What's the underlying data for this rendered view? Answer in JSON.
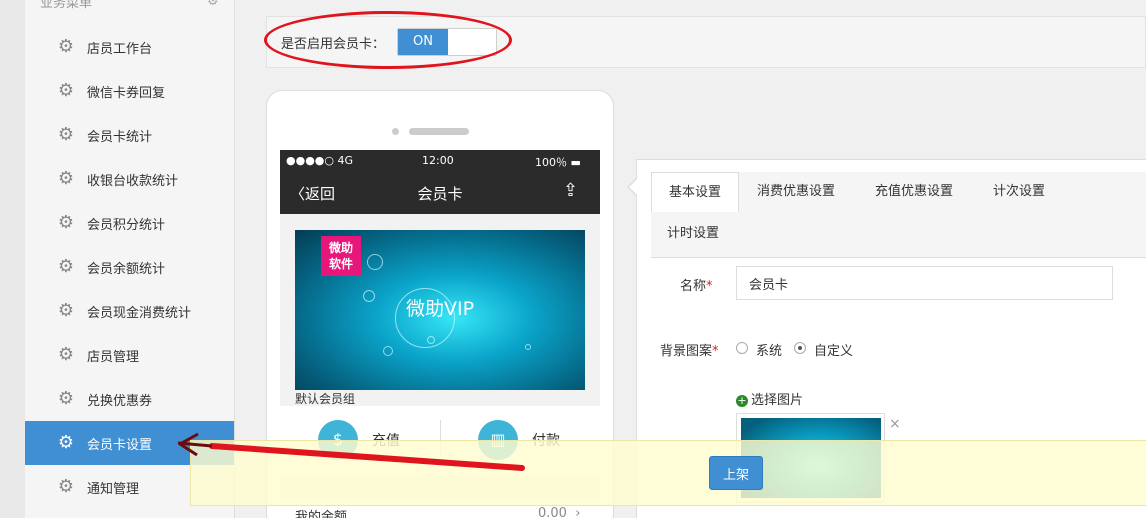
{
  "sidebar": {
    "title": "业务菜单",
    "items": [
      {
        "label": "店员工作台"
      },
      {
        "label": "微信卡券回复"
      },
      {
        "label": "会员卡统计"
      },
      {
        "label": "收银台收款统计"
      },
      {
        "label": "会员积分统计"
      },
      {
        "label": "会员余额统计"
      },
      {
        "label": "会员现金消费统计"
      },
      {
        "label": "店员管理"
      },
      {
        "label": "兑换优惠券"
      },
      {
        "label": "会员卡设置",
        "active": true
      },
      {
        "label": "通知管理"
      }
    ]
  },
  "topbar": {
    "toggle_label": "是否启用会员卡：",
    "toggle_state": "ON"
  },
  "phone": {
    "status": {
      "signal": "●●●●○ 4G",
      "time": "12:00",
      "battery": "100％ ▬"
    },
    "nav": {
      "back": "返回",
      "title": "会员卡"
    },
    "card": {
      "brand_line1": "微助",
      "brand_line2": "软件",
      "title": "微助VIP"
    },
    "group_name": "默认会员组",
    "actions": [
      {
        "label": "充值"
      },
      {
        "label": "付款"
      }
    ],
    "balance": {
      "label": "我的余额",
      "value": "0.00",
      "arrow": "›"
    }
  },
  "form": {
    "tabs": [
      {
        "label": "基本设置",
        "active": true
      },
      {
        "label": "消费优惠设置"
      },
      {
        "label": "充值优惠设置"
      },
      {
        "label": "计次设置"
      },
      {
        "label": "计时设置"
      }
    ],
    "name_label": "名称",
    "name_value": "会员卡",
    "bg_label": "背景图案",
    "bg_options": [
      {
        "label": "系统"
      },
      {
        "label": "自定义",
        "checked": true
      }
    ],
    "pick_image": "选择图片",
    "remove_image": "×"
  },
  "footer": {
    "publish_label": "上架"
  },
  "colors": {
    "accent": "#3f8fd2",
    "annotation_red": "#e0141c",
    "brand_pink": "#e8157a"
  }
}
